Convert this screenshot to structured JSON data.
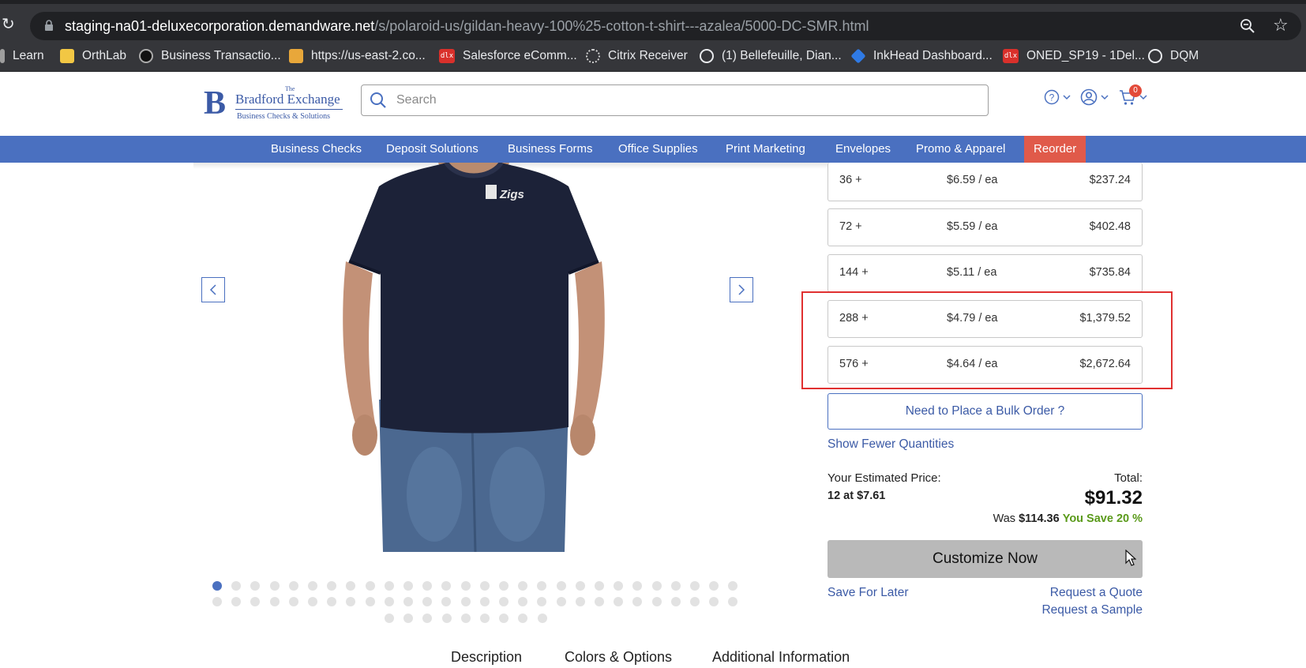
{
  "browser": {
    "url_host": "staging-na01-deluxecorporation.demandware.net",
    "url_path": "/s/polaroid-us/gildan-heavy-100%25-cotton-t-shirt---azalea/5000-DC-SMR.html",
    "bookmarks": [
      {
        "label": "Learn",
        "icon": "generic-icon",
        "color": "#9e9e9e"
      },
      {
        "label": "OrthLab",
        "icon": "folder-icon",
        "color": "#f2c744"
      },
      {
        "label": "Business Transactio...",
        "icon": "black-circle-icon",
        "color": "#111111"
      },
      {
        "label": "https://us-east-2.co...",
        "icon": "box-icon",
        "color": "#e8a73a"
      },
      {
        "label": "Salesforce eComm...",
        "icon": "dlx-icon",
        "color": "#d9302b"
      },
      {
        "label": "Citrix Receiver",
        "icon": "citrix-icon",
        "color": "#cfcfcf"
      },
      {
        "label": "(1) Bellefeuille, Dian...",
        "icon": "globe-icon",
        "color": "#e8eaed"
      },
      {
        "label": "InkHead Dashboard...",
        "icon": "diamond-icon",
        "color": "#2f7ae5"
      },
      {
        "label": "ONED_SP19 - 1Del...",
        "icon": "dlx-icon",
        "color": "#d9302b"
      },
      {
        "label": "DQM",
        "icon": "globe-icon",
        "color": "#e8eaed"
      }
    ],
    "dlx_text": "dlx"
  },
  "header": {
    "logo": {
      "the": "The",
      "name": "Bradford Exchange",
      "tagline": "Business Checks & Solutions"
    },
    "search_placeholder": "Search",
    "cart_count": "0"
  },
  "nav": {
    "items": [
      "Business Checks",
      "Deposit Solutions",
      "Business Forms",
      "Office Supplies",
      "Print Marketing",
      "Envelopes",
      "Promo & Apparel",
      "Reorder"
    ]
  },
  "product": {
    "shirt_logo_text": "Zigs",
    "image_count_dots": 65,
    "active_dot": 0
  },
  "pricing": {
    "tiers": [
      {
        "qty": "36 +",
        "unit": "$6.59 / ea",
        "total": "$237.24"
      },
      {
        "qty": "72 +",
        "unit": "$5.59 / ea",
        "total": "$402.48"
      },
      {
        "qty": "144 +",
        "unit": "$5.11 / ea",
        "total": "$735.84"
      },
      {
        "qty": "288 +",
        "unit": "$4.79 / ea",
        "total": "$1,379.52"
      },
      {
        "qty": "576 +",
        "unit": "$4.64 / ea",
        "total": "$2,672.64"
      }
    ],
    "bulk_order_label": "Need to Place a Bulk Order ?",
    "show_fewer_label": "Show Fewer Quantities",
    "estimated_label": "Your Estimated Price:",
    "estimated_value": "12 at $7.61",
    "total_label": "Total:",
    "total_value": "$91.32",
    "was_label": "Was",
    "was_value": "$114.36",
    "save_label": "You Save 20 %",
    "customize_label": "Customize Now",
    "save_later_label": "Save For Later",
    "request_quote_label": "Request a Quote",
    "request_sample_label": "Request a Sample"
  },
  "tabs": [
    "Description",
    "Colors & Options",
    "Additional Information"
  ],
  "colors": {
    "brand_blue": "#4a70c0",
    "reorder_red": "#e05a4a",
    "highlight_red": "#e03030",
    "save_green": "#5a9a1a"
  }
}
